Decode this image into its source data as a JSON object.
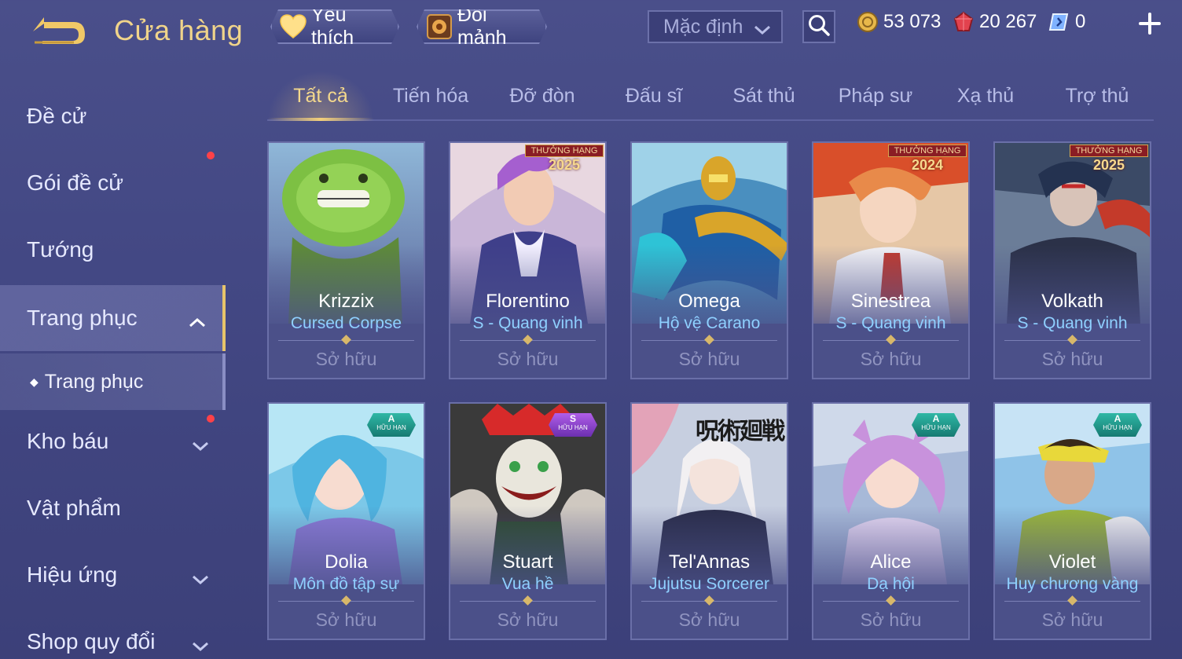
{
  "header": {
    "title": "Cửa hàng",
    "favorite_label": "Yêu thích",
    "exchange_label": "Đổi mảnh",
    "sort_selected": "Mặc định",
    "currencies": [
      {
        "name": "gold",
        "value": "53 073",
        "color": "#e8b84a"
      },
      {
        "name": "ruby",
        "value": "20 267",
        "color": "#e2424e"
      },
      {
        "name": "voucher",
        "value": "0",
        "color": "#7fb2ff"
      }
    ]
  },
  "sidebar": {
    "items": [
      {
        "label": "Đề cử"
      },
      {
        "label": "Gói đề cử"
      },
      {
        "label": "Tướng"
      },
      {
        "label": "Trang phục"
      },
      {
        "label": "Kho báu"
      },
      {
        "label": "Vật phẩm"
      },
      {
        "label": "Hiệu ứng"
      },
      {
        "label": "Shop quy đổi"
      }
    ],
    "sub_item": "Trang phục"
  },
  "tabs": [
    "Tất cả",
    "Tiến hóa",
    "Đỡ đòn",
    "Đấu sĩ",
    "Sát thủ",
    "Pháp sư",
    "Xạ thủ",
    "Trợ thủ"
  ],
  "cards": [
    {
      "hero": "Krizzix",
      "skin": "Cursed Corpse",
      "status": "Sở hữu"
    },
    {
      "hero": "Florentino",
      "skin": "S - Quang vinh",
      "status": "Sở hữu",
      "rank_badge": "THƯỞNG HẠNG",
      "rank_year": "2025"
    },
    {
      "hero": "Omega",
      "skin": "Hộ vệ Carano",
      "status": "Sở hữu"
    },
    {
      "hero": "Sinestrea",
      "skin": "S - Quang vinh",
      "status": "Sở hữu",
      "rank_badge": "THƯỞNG HẠNG",
      "rank_year": "2024"
    },
    {
      "hero": "Volkath",
      "skin": "S - Quang vinh",
      "status": "Sở hữu",
      "rank_badge": "THƯỞNG HẠNG",
      "rank_year": "2025"
    },
    {
      "hero": "Dolia",
      "skin": "Môn đồ tập sự",
      "status": "Sở hữu",
      "tier": "A",
      "tier_note": "HỮU HẠN"
    },
    {
      "hero": "Stuart",
      "skin": "Vua hề",
      "status": "Sở hữu",
      "tier": "S",
      "tier_note": "HỮU HẠN"
    },
    {
      "hero": "Tel'Annas",
      "skin": "Jujutsu Sorcerer",
      "status": "Sở hữu",
      "collab_title": "呪術廻戦"
    },
    {
      "hero": "Alice",
      "skin": "Dạ hội",
      "status": "Sở hữu",
      "tier": "A",
      "tier_note": "HỮU HẠN"
    },
    {
      "hero": "Violet",
      "skin": "Huy chương vàng",
      "status": "Sở hữu",
      "tier": "A",
      "tier_note": "HỮU HẠN"
    }
  ],
  "colors": {
    "accent_gold": "#f4d88c",
    "skin_name": "#8fd0ff",
    "notification": "#ff4148"
  }
}
